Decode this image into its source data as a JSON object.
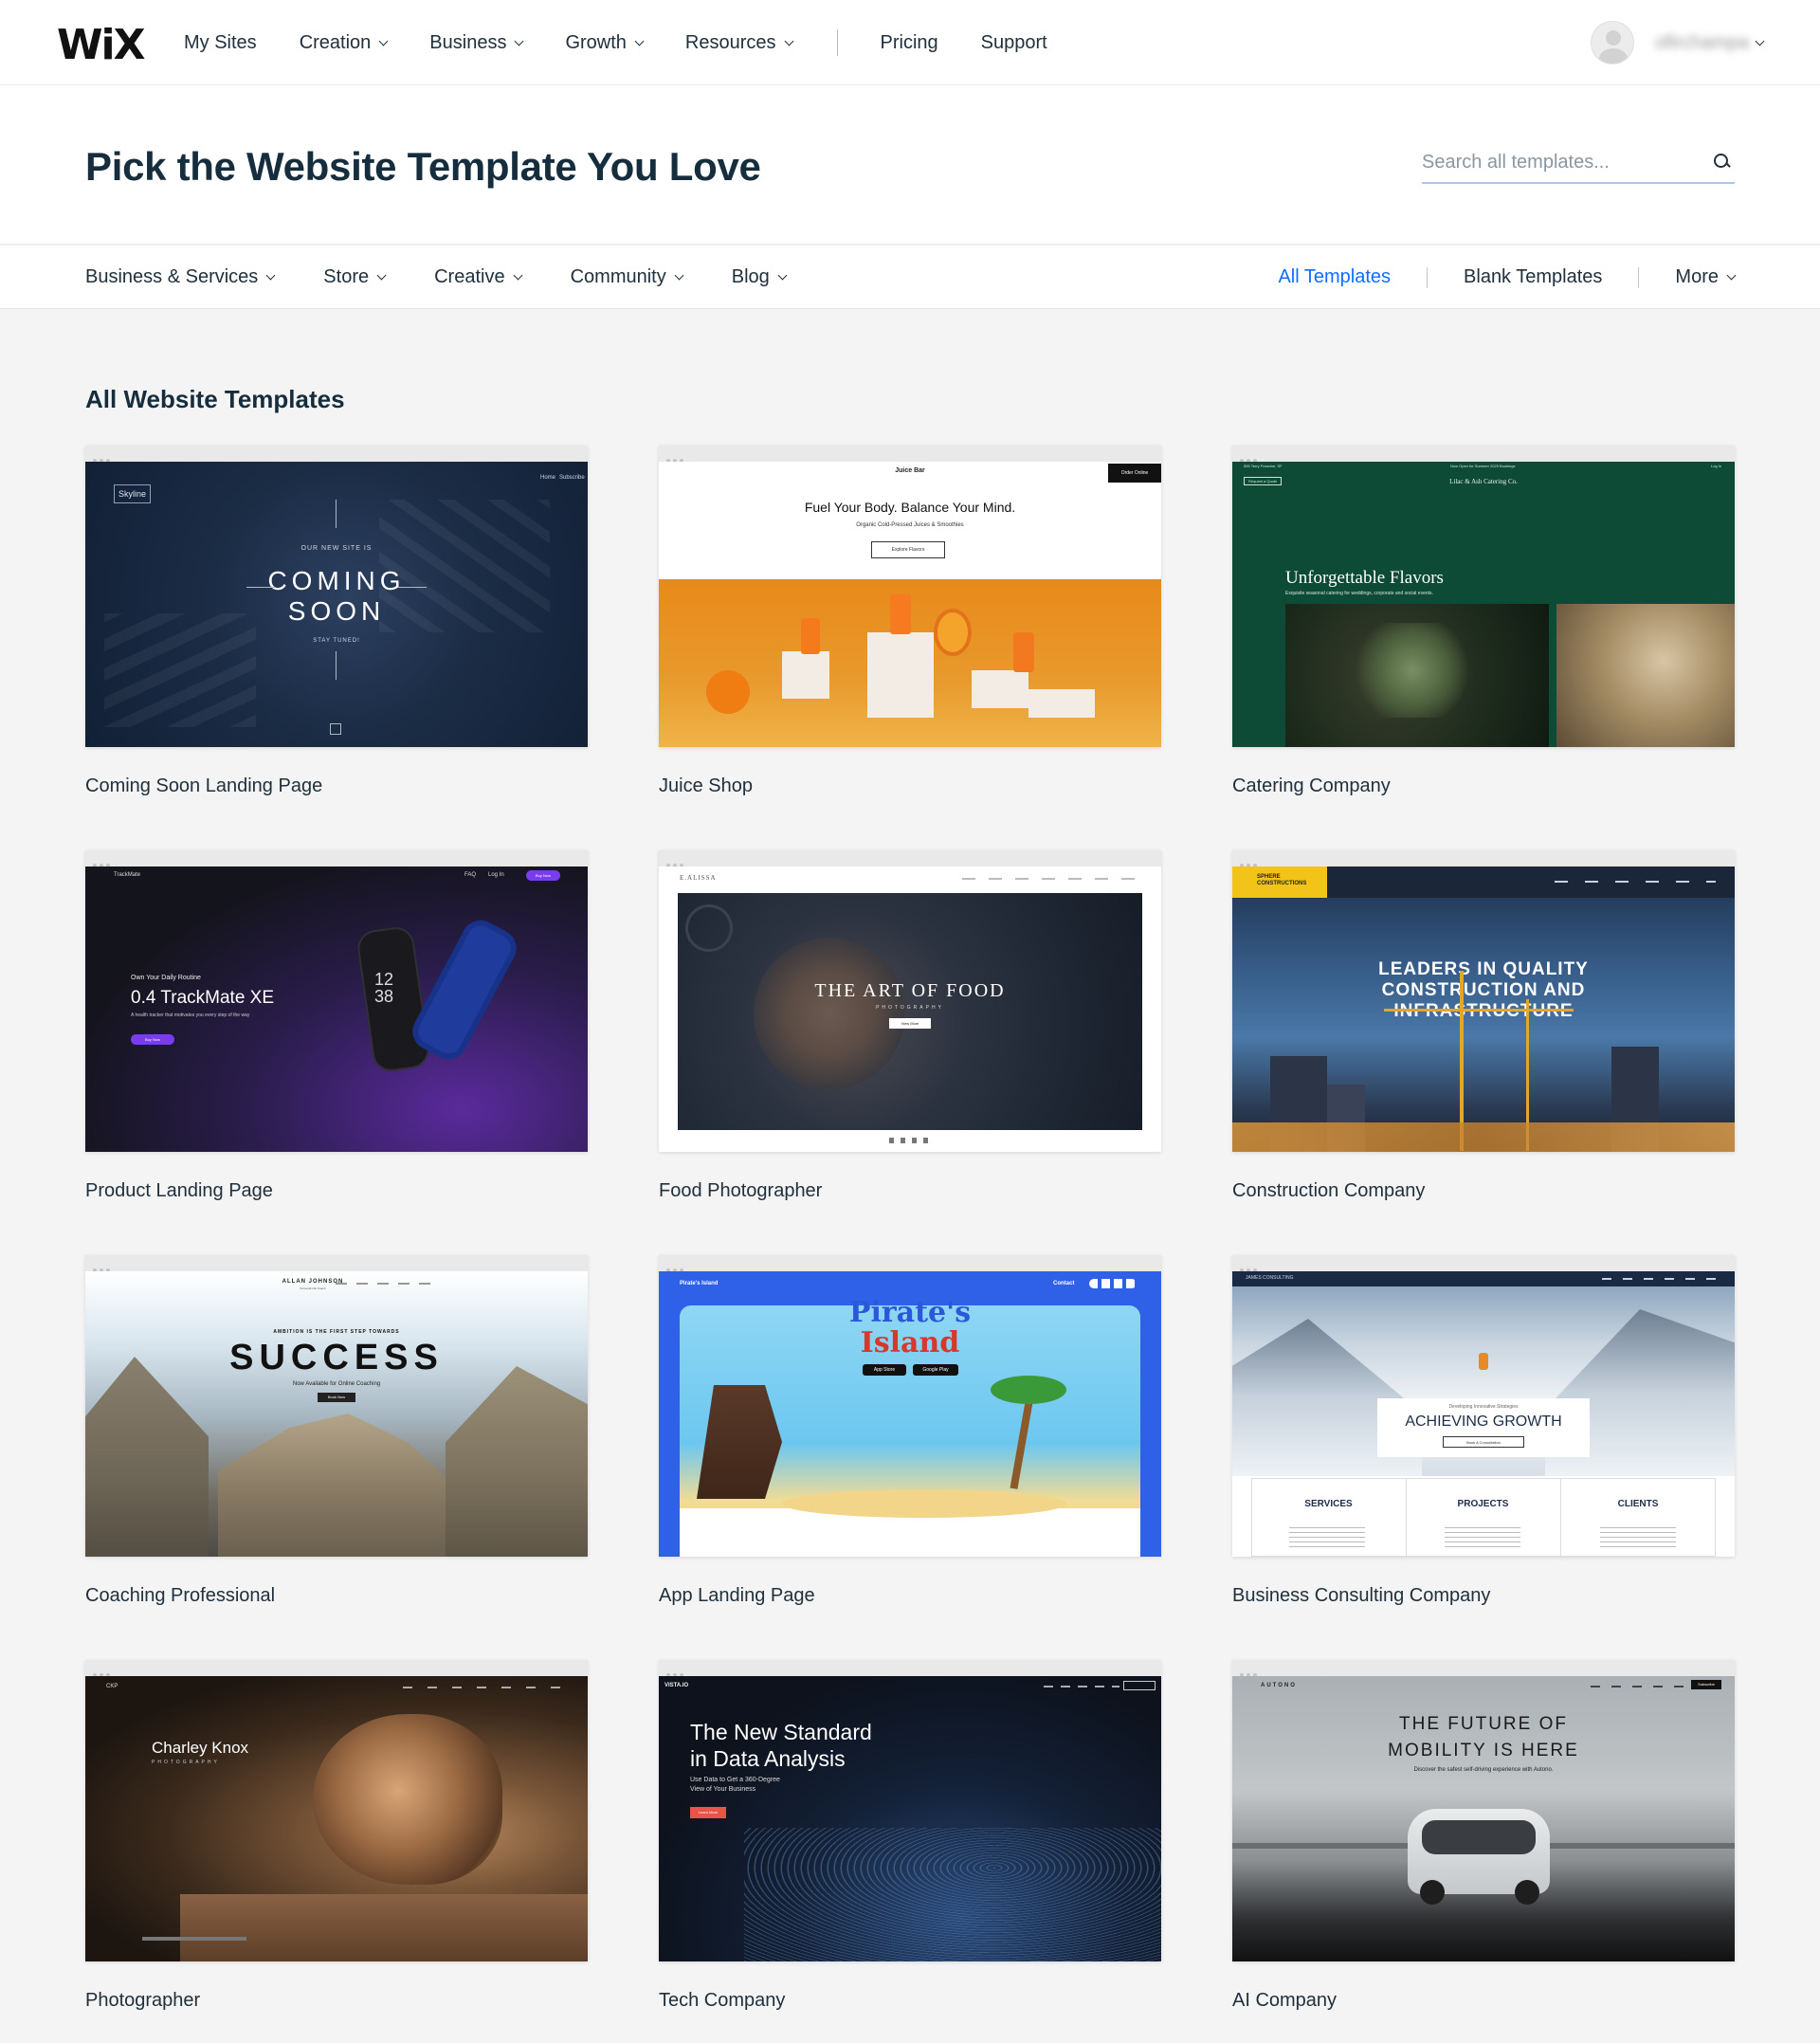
{
  "topnav": {
    "logo": "WiX",
    "items": [
      {
        "label": "My Sites",
        "dropdown": false
      },
      {
        "label": "Creation",
        "dropdown": true
      },
      {
        "label": "Business",
        "dropdown": true
      },
      {
        "label": "Growth",
        "dropdown": true
      },
      {
        "label": "Resources",
        "dropdown": true
      }
    ],
    "secondary": [
      {
        "label": "Pricing"
      },
      {
        "label": "Support"
      }
    ],
    "username": "ofirchampa"
  },
  "header": {
    "title": "Pick the Website Template You Love",
    "search_placeholder": "Search all templates..."
  },
  "categories": {
    "left": [
      "Business & Services",
      "Store",
      "Creative",
      "Community",
      "Blog"
    ],
    "all_templates": "All Templates",
    "blank_templates": "Blank Templates",
    "more": "More"
  },
  "section_title": "All Website Templates",
  "templates": [
    {
      "name": "Coming Soon Landing Page",
      "thumb": {
        "brand": "Skyline",
        "kicker": "OUR NEW SITE IS",
        "line1": "COMING",
        "line2": "SOON",
        "sub": "STAY TUNED!",
        "nav1": "Home",
        "nav2": "Subscribe"
      }
    },
    {
      "name": "Juice Shop",
      "thumb": {
        "brand": "Juice Bar",
        "headline": "Fuel Your Body. Balance Your Mind.",
        "sub": "Organic Cold-Pressed Juices & Smoothies",
        "cta": "Explore Flavors",
        "order": "Order Online"
      }
    },
    {
      "name": "Catering Company",
      "thumb": {
        "brand": "Lilac & Ash Catering Co.",
        "quote": "Request a Quote",
        "headline": "Unforgettable Flavors",
        "sub": "Exquisite seasonal catering for weddings, corporate and social events.",
        "top_left": "555 Terry Francine, SF",
        "top_mid": "Now Open for Summer 2025 Bookings",
        "login": "Log In"
      }
    },
    {
      "name": "Product Landing Page",
      "thumb": {
        "brand": "TrackMate",
        "kicker": "Own Your Daily Routine",
        "headline": "0.4 TrackMate XE",
        "sub": "A health tracker that motivates you every step of the way",
        "cta": "Buy Now",
        "faq": "FAQ",
        "login": "Log In",
        "buy": "Buy Now",
        "watch1": "12",
        "watch2": "38"
      }
    },
    {
      "name": "Food Photographer",
      "thumb": {
        "brand": "E.ALISSA",
        "headline": "THE ART OF FOOD",
        "sub": "PHOTOGRAPHY",
        "cta": "View More"
      }
    },
    {
      "name": "Construction Company",
      "thumb": {
        "brand": "SPHERE CONSTRUCTIONS",
        "line1": "LEADERS IN QUALITY",
        "line2": "CONSTRUCTION AND",
        "line3": "INFRASTRUCTURE"
      }
    },
    {
      "name": "Coaching Professional",
      "thumb": {
        "brand": "ALLAN JOHNSON",
        "tagline": "Personal Life Coach",
        "kicker": "AMBITION IS THE FIRST STEP TOWARDS",
        "headline": "SUCCESS",
        "sub": "Now Available for Online Coaching",
        "cta": "Book Now"
      }
    },
    {
      "name": "App Landing Page",
      "thumb": {
        "brand": "Pirate's Island",
        "line1": "Pirate's",
        "line2": "Island",
        "contact": "Contact",
        "store1": "App Store",
        "store2": "Google Play"
      }
    },
    {
      "name": "Business Consulting Company",
      "thumb": {
        "brand": "JAMES CONSULTING",
        "kicker": "Developing Innovative Strategies",
        "headline": "ACHIEVING GROWTH",
        "cta": "Book A Consultation",
        "col1": "SERVICES",
        "col2": "PROJECTS",
        "col3": "CLIENTS"
      }
    },
    {
      "name": "Photographer",
      "thumb": {
        "brand": "CKP",
        "headline": "Charley Knox",
        "sub": "PHOTOGRAPHY"
      }
    },
    {
      "name": "Tech Company",
      "thumb": {
        "brand": "VISTA.IO",
        "line1": "The New Standard",
        "line2": "in Data Analysis",
        "sub1": "Use Data to Get a 360-Degree",
        "sub2": "View of Your Business",
        "cta": "Learn More"
      }
    },
    {
      "name": "AI Company",
      "thumb": {
        "brand": "AUTONO",
        "line1": "THE FUTURE OF",
        "line2": "MOBILITY IS HERE",
        "sub": "Discover the safest self-driving experience with Autono.",
        "cta": "Subscribe"
      }
    }
  ],
  "colors": {
    "accent": "#116dff",
    "title": "#162d3d",
    "background": "#f4f4f4"
  }
}
